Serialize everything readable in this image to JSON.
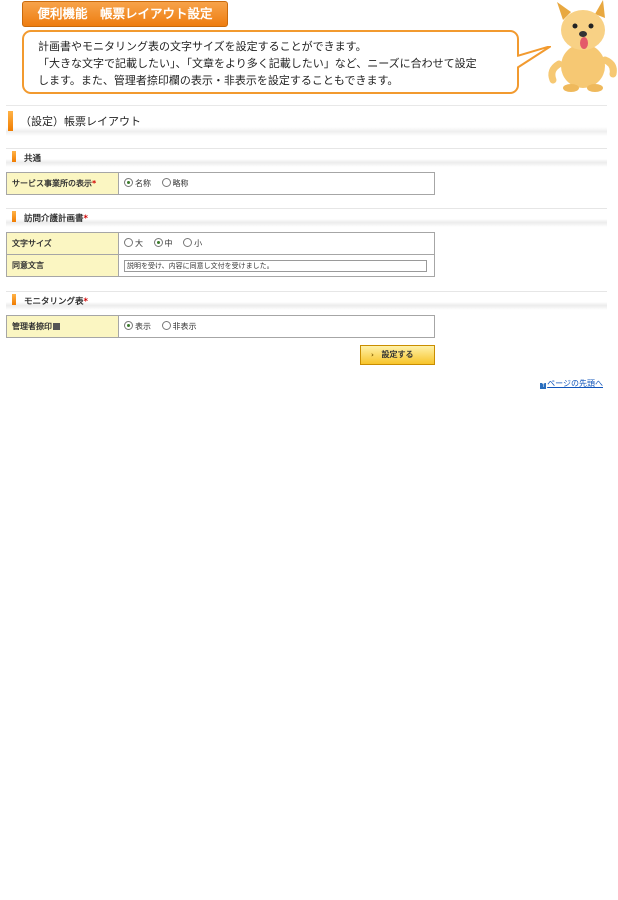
{
  "header": {
    "feature_tag": "便利機能　帳票レイアウト設定",
    "bubble_lines": [
      "計画書やモニタリング表の文字サイズを設定することができます。",
      "「大きな文字で記載したい」、「文章をより多く記載したい」など、ニーズに合わせて設定",
      "します。また、管理者捺印欄の表示・非表示を設定することもできます。"
    ]
  },
  "page_title": "（設定）帳票レイアウト",
  "sections": {
    "common": {
      "title": "共通",
      "service_office_label": "サービス事業所の表示",
      "required_mark": "*",
      "options": [
        "名称",
        "略称"
      ],
      "selected": "名称"
    },
    "plan": {
      "title": "訪問介護計画書",
      "required_mark": "*",
      "font_size_label": "文字サイズ",
      "font_size_options": [
        "大",
        "中",
        "小"
      ],
      "font_size_selected": "中",
      "consent_label": "同意文言",
      "consent_value": "説明を受け、内容に同意し文付を受けました。"
    },
    "monitoring": {
      "title": "モニタリング表",
      "required_mark": "*",
      "seal_label": "管理者捺印",
      "seal_options": [
        "表示",
        "非表示"
      ],
      "seal_selected": "表示"
    }
  },
  "actions": {
    "submit_label": "設定する",
    "back_to_top": "ページの先頭へ"
  },
  "colors": {
    "accent_orange": "#ee7d10",
    "label_bg": "#fbf6c2",
    "required": "#d00000",
    "link": "#1155bb"
  }
}
